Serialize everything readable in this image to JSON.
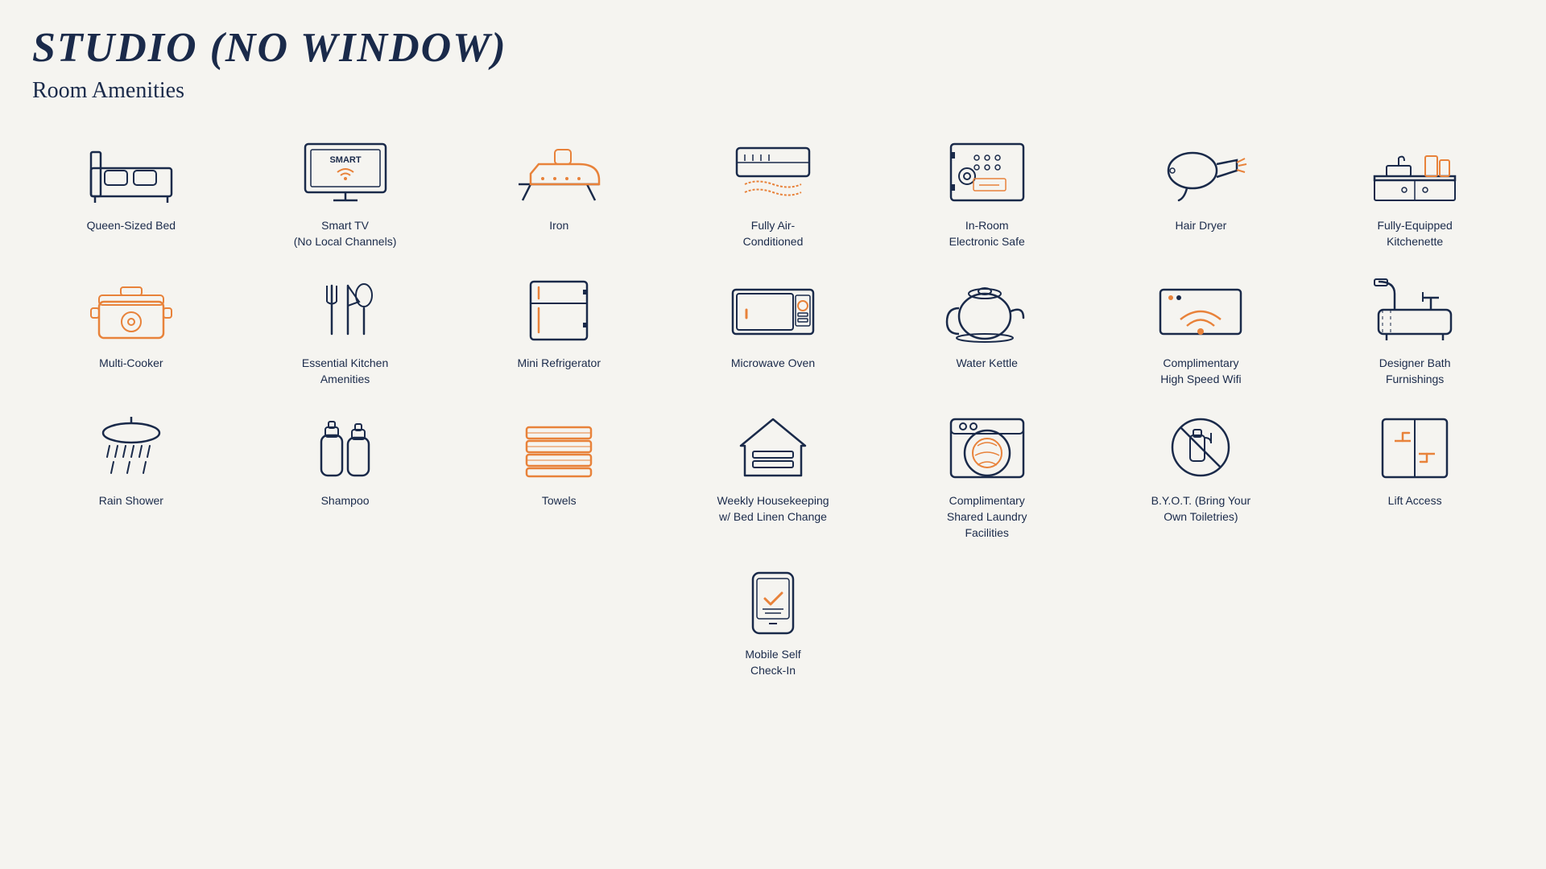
{
  "title": "STUDIO (NO WINDOW)",
  "subtitle": "Room Amenities",
  "amenities": [
    {
      "id": "queen-bed",
      "label": "Queen-Sized Bed"
    },
    {
      "id": "smart-tv",
      "label": "Smart TV\n(No Local Channels)"
    },
    {
      "id": "iron",
      "label": "Iron"
    },
    {
      "id": "air-conditioned",
      "label": "Fully Air-\nConditioned"
    },
    {
      "id": "electronic-safe",
      "label": "In-Room\nElectronic Safe"
    },
    {
      "id": "hair-dryer",
      "label": "Hair Dryer"
    },
    {
      "id": "kitchenette",
      "label": "Fully-Equipped\nKitchenette"
    },
    {
      "id": "multi-cooker",
      "label": "Multi-Cooker"
    },
    {
      "id": "kitchen-amenities",
      "label": "Essential Kitchen\nAmenities"
    },
    {
      "id": "mini-fridge",
      "label": "Mini Refrigerator"
    },
    {
      "id": "microwave",
      "label": "Microwave Oven"
    },
    {
      "id": "water-kettle",
      "label": "Water Kettle"
    },
    {
      "id": "wifi",
      "label": "Complimentary\nHigh Speed Wifi"
    },
    {
      "id": "bath-furnishings",
      "label": "Designer Bath\nFurnishings"
    },
    {
      "id": "rain-shower",
      "label": "Rain Shower"
    },
    {
      "id": "shampoo",
      "label": "Shampoo"
    },
    {
      "id": "towels",
      "label": "Towels"
    },
    {
      "id": "housekeeping",
      "label": "Weekly Housekeeping\nw/ Bed Linen Change"
    },
    {
      "id": "laundry",
      "label": "Complimentary\nShared Laundry\nFacilities"
    },
    {
      "id": "byot",
      "label": "B.Y.O.T. (Bring Your\nOwn Toiletries)"
    },
    {
      "id": "lift",
      "label": "Lift Access"
    },
    {
      "id": "mobile-checkin",
      "label": "Mobile Self\nCheck-In"
    }
  ]
}
